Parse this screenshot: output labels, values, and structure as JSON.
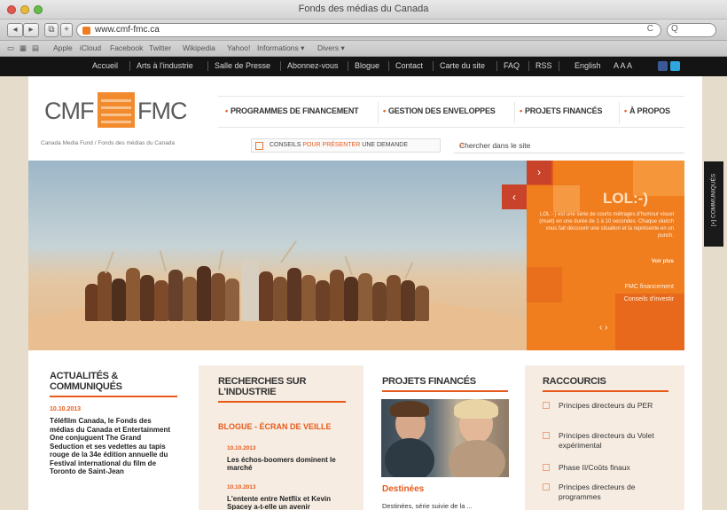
{
  "window": {
    "title": "Fonds des médias du Canada"
  },
  "toolbar": {
    "back": "◂",
    "forward": "▸",
    "share": "⧉",
    "add": "+",
    "url": "www.cmf-fmc.ca",
    "reload": "C",
    "search_placeholder": "Q"
  },
  "bookmarks": [
    "Apple",
    "iCloud",
    "Facebook",
    "Twitter",
    "Wikipedia",
    "Yahoo!",
    "Informations ▾",
    "Divers ▾"
  ],
  "bookmarks_icons": [
    "reading-list-icon",
    "top-sites-icon",
    "bookmarks-grid-icon"
  ],
  "sitenav": {
    "items": [
      "Accueil",
      "Arts à l'industrie",
      "Salle de Presse",
      "Abonnez-vous",
      "Blogue",
      "Contact",
      "Carte du site",
      "FAQ",
      "RSS",
      "English",
      "A A A"
    ],
    "social": [
      "facebook-icon",
      "twitter-icon"
    ]
  },
  "logo": {
    "left": "CMF",
    "right": "FMC",
    "tagline": "Canada Media Fund / Fonds des médias du Canada"
  },
  "mainnav": {
    "items": [
      "PROGRAMMES DE FINANCEMENT",
      "GESTION DES ENVELOPPES",
      "PROJETS FINANCÉS",
      "À PROPOS"
    ]
  },
  "conseil": {
    "prefix": "CONSEILS ",
    "highlight": "POUR PRÉSENTER",
    "suffix": " UNE DEMANDE"
  },
  "search": {
    "placeholder": "Chercher dans le site",
    "icon": "search-icon"
  },
  "hero": {
    "prev": "‹",
    "next": "›",
    "promo_title": "LOL:-)",
    "promo_body": "LOL :-) est une série de courts métrages d'humour visuel (muet) en une durée de 1 à 10 secondes. Chaque sketch vous fait découvrir une situation et la représente en un punch.",
    "promo_more": "Voir plus",
    "promo_link1": "FMC financement",
    "promo_link2": "Conseils d'investir",
    "promo_arrows": "‹ ›",
    "side_tab": "[+] COMMUNIQUÉS"
  },
  "columns": {
    "news": {
      "title_l1": "ACTUALITÉS &",
      "title_l2": "COMMUNIQUÉS",
      "date": "10.10.2013",
      "body": "Téléfilm Canada, le Fonds des médias du Canada et Entertainment One conjuguent The Grand Seduction et ses vedettes au tapis rouge de la 34e édition annuelle du Festival international du film de Toronto de Saint-Jean"
    },
    "research": {
      "title_l1": "RECHERCHES SUR",
      "title_l2": "L'INDUSTRIE",
      "blog_heading": "BLOGUE - ÉCRAN DE VEILLE",
      "items": [
        {
          "date": "10.10.2013",
          "title": "Les échos-boomers dominent le marché"
        },
        {
          "date": "10.10.2013",
          "title": "L'entente entre Netflix et Kevin Spacey a-t-elle un avenir"
        }
      ]
    },
    "projects": {
      "title": "PROJETS FINANCÉS",
      "feature_title": "Destinées",
      "feature_body": "Destinées, série suivie de la ..."
    },
    "shortcuts": {
      "title": "RACCOURCIS",
      "items": [
        "Principes directeurs du PER",
        "Principes directeurs du Volet expérimental",
        "Phase II/Coûts finaux",
        "Principes directeurs de programmes"
      ]
    }
  },
  "colors": {
    "accent": "#e85a1b",
    "promo": "#f07d1e",
    "nav_bg": "#141414",
    "page_bg": "#e6dccb"
  }
}
